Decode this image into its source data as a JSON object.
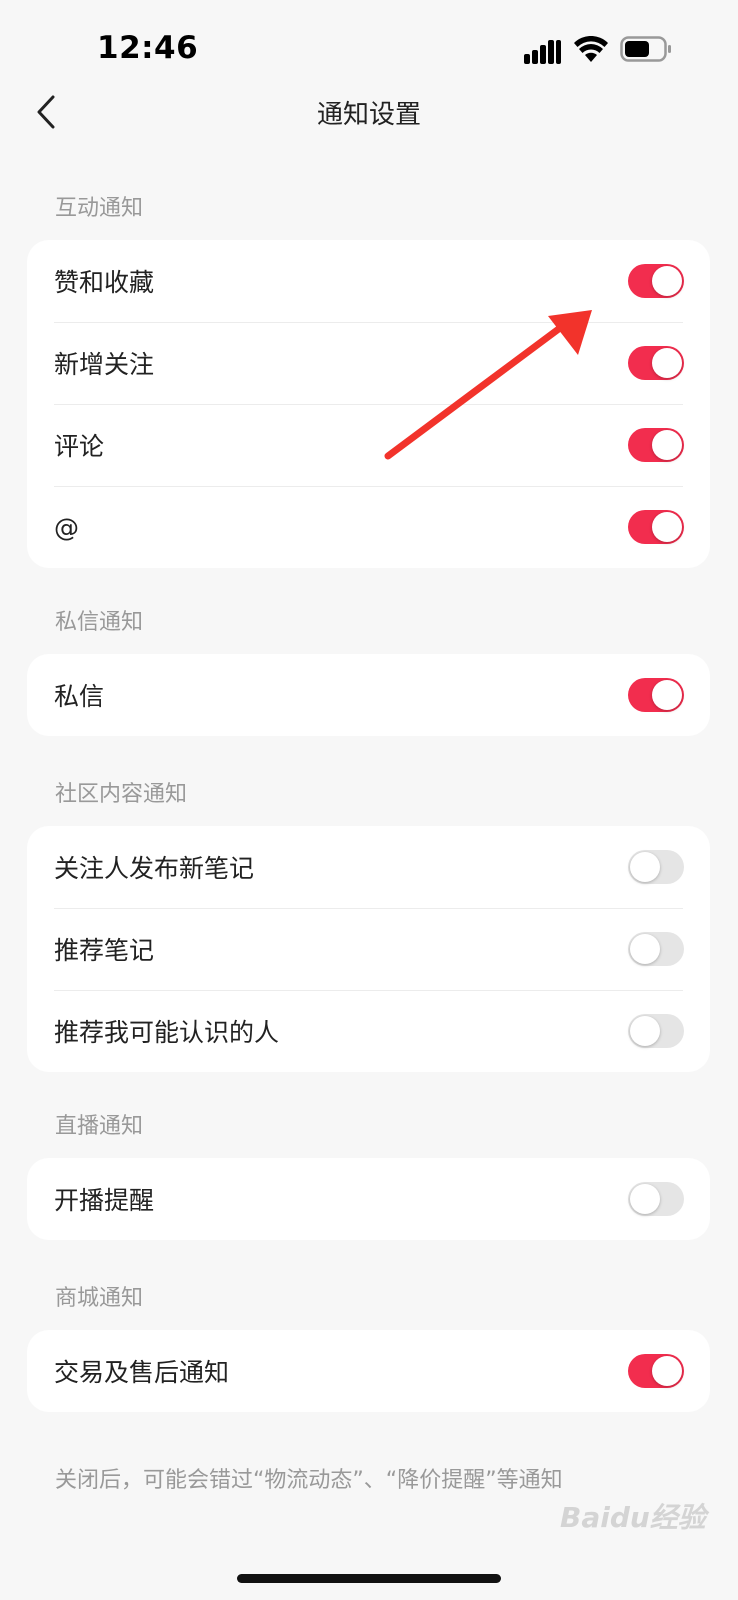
{
  "status_bar": {
    "time": "12:46"
  },
  "nav": {
    "title": "通知设置",
    "back_icon": "chevron-left-icon"
  },
  "sections": [
    {
      "header": "互动通知",
      "rows": [
        {
          "label": "赞和收藏",
          "on": true
        },
        {
          "label": "新增关注",
          "on": true
        },
        {
          "label": "评论",
          "on": true
        },
        {
          "label": "@",
          "on": true
        }
      ]
    },
    {
      "header": "私信通知",
      "rows": [
        {
          "label": "私信",
          "on": true
        }
      ]
    },
    {
      "header": "社区内容通知",
      "rows": [
        {
          "label": "关注人发布新笔记",
          "on": false
        },
        {
          "label": "推荐笔记",
          "on": false
        },
        {
          "label": "推荐我可能认识的人",
          "on": false
        }
      ]
    },
    {
      "header": "直播通知",
      "rows": [
        {
          "label": "开播提醒",
          "on": false
        }
      ]
    },
    {
      "header": "商城通知",
      "rows": [
        {
          "label": "交易及售后通知",
          "on": true
        }
      ]
    }
  ],
  "footer_note": "关闭后，可能会错过“物流动态”、“降价提醒”等通知",
  "watermark": "Baidu经验",
  "colors": {
    "toggle_on": "#f22d4e",
    "toggle_off": "#e5e5e5",
    "annotation_arrow": "#f2332b"
  }
}
